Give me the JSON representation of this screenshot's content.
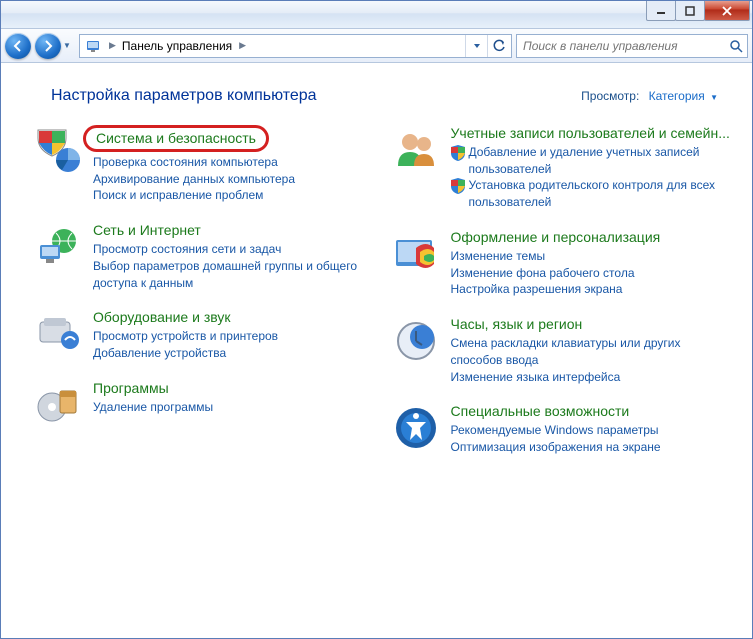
{
  "window": {
    "breadcrumb_item": "Панель управления",
    "search_placeholder": "Поиск в панели управления"
  },
  "header": {
    "title": "Настройка параметров компьютера",
    "view_label": "Просмотр:",
    "view_value": "Категория"
  },
  "left": [
    {
      "id": "system-security",
      "title": "Система и безопасность",
      "highlight": true,
      "subs": [
        {
          "text": "Проверка состояния компьютера"
        },
        {
          "text": "Архивирование данных компьютера"
        },
        {
          "text": "Поиск и исправление проблем"
        }
      ]
    },
    {
      "id": "network",
      "title": "Сеть и Интернет",
      "subs": [
        {
          "text": "Просмотр состояния сети и задач"
        },
        {
          "text": "Выбор параметров домашней группы и общего доступа к данным"
        }
      ]
    },
    {
      "id": "hardware",
      "title": "Оборудование и звук",
      "subs": [
        {
          "text": "Просмотр устройств и принтеров"
        },
        {
          "text": "Добавление устройства"
        }
      ]
    },
    {
      "id": "programs",
      "title": "Программы",
      "subs": [
        {
          "text": "Удаление программы"
        }
      ]
    }
  ],
  "right": [
    {
      "id": "users",
      "title": "Учетные записи пользователей и семейн...",
      "subs": [
        {
          "shield": true,
          "text": "Добавление и удаление учетных записей пользователей"
        },
        {
          "shield": true,
          "text": "Установка родительского контроля для всех пользователей"
        }
      ]
    },
    {
      "id": "appearance",
      "title": "Оформление и персонализация",
      "subs": [
        {
          "text": "Изменение темы"
        },
        {
          "text": "Изменение фона рабочего стола"
        },
        {
          "text": "Настройка разрешения экрана"
        }
      ]
    },
    {
      "id": "clock",
      "title": "Часы, язык и регион",
      "subs": [
        {
          "text": "Смена раскладки клавиатуры или других способов ввода"
        },
        {
          "text": "Изменение языка интерфейса"
        }
      ]
    },
    {
      "id": "access",
      "title": "Специальные возможности",
      "subs": [
        {
          "text": "Рекомендуемые Windows параметры"
        },
        {
          "text": "Оптимизация изображения на экране"
        }
      ]
    }
  ]
}
